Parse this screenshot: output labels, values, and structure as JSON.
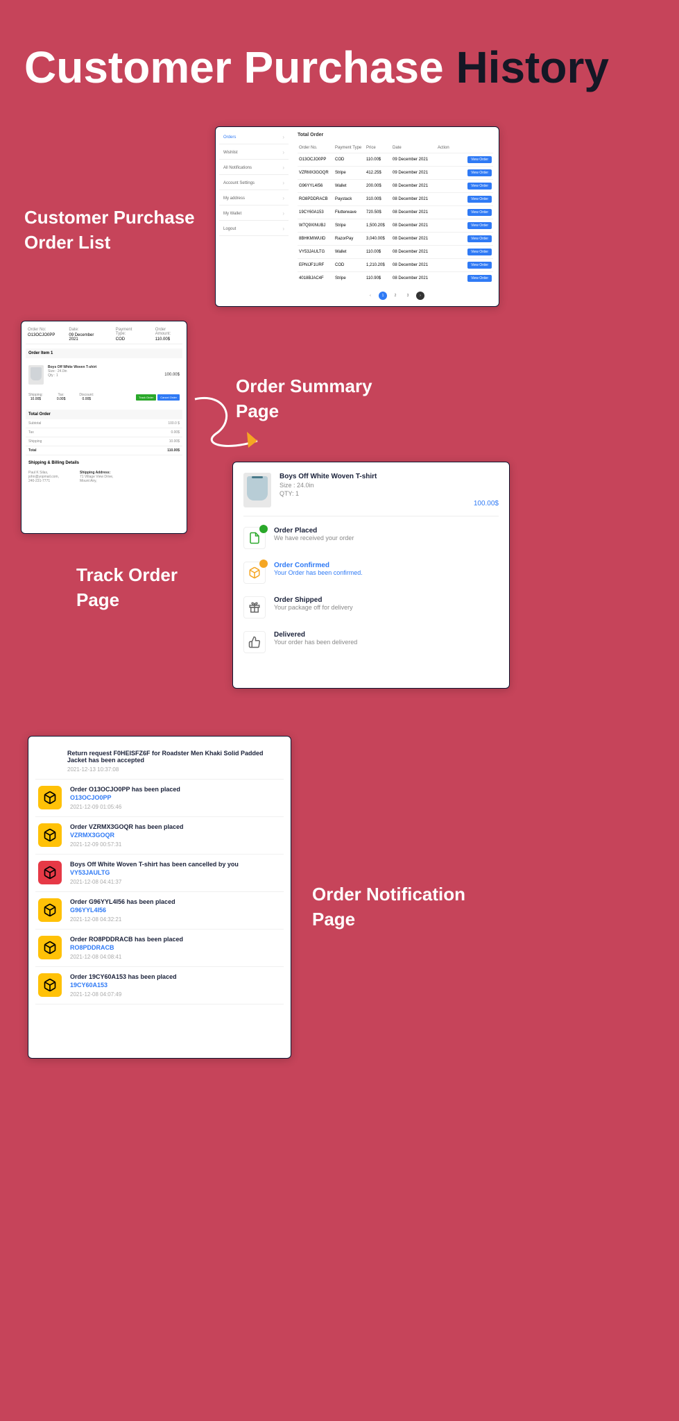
{
  "title": {
    "a": "Customer Purchase ",
    "b": "History"
  },
  "labels": {
    "order_list": "Customer Purchase\nOrder List",
    "summary": "Order Summary\nPage",
    "track": "Track Order\nPage",
    "notif": "Order Notification\nPage"
  },
  "sidebar": {
    "items": [
      {
        "label": "Orders",
        "active": true
      },
      {
        "label": "Wishlist"
      },
      {
        "label": "All Notifications"
      },
      {
        "label": "Account Settings"
      },
      {
        "label": "My address"
      },
      {
        "label": "My Wallet"
      },
      {
        "label": "Logout"
      }
    ]
  },
  "orders": {
    "title": "Total Order",
    "headers": {
      "no": "Order No.",
      "pay": "Payment Type",
      "price": "Price",
      "date": "Date",
      "action": "Action"
    },
    "view_label": "View Order",
    "rows": [
      {
        "no": "O13OCJO0PP",
        "pay": "COD",
        "price": "110.00$",
        "date": "09 December 2021"
      },
      {
        "no": "VZRMX3GOQR",
        "pay": "Stripe",
        "price": "412.25$",
        "date": "09 December 2021"
      },
      {
        "no": "G96YYL4I56",
        "pay": "Wallet",
        "price": "200.00$",
        "date": "08 December 2021"
      },
      {
        "no": "RO8PDDRACB",
        "pay": "Paystack",
        "price": "310.00$",
        "date": "08 December 2021"
      },
      {
        "no": "19CY60A153",
        "pay": "Flutterwave",
        "price": "720.50$",
        "date": "08 December 2021"
      },
      {
        "no": "W7Q9XINUBJ",
        "pay": "Stripe",
        "price": "1,500.20$",
        "date": "08 December 2021"
      },
      {
        "no": "8BHKMIWUID",
        "pay": "RazorPay",
        "price": "3,040.00$",
        "date": "08 December 2021"
      },
      {
        "no": "VY53JAULTG",
        "pay": "Wallet",
        "price": "110.00$",
        "date": "08 December 2021"
      },
      {
        "no": "EPNIJF1URF",
        "pay": "COD",
        "price": "1,210.20$",
        "date": "08 December 2021"
      },
      {
        "no": "4018BJAC4F",
        "pay": "Stripe",
        "price": "110.90$",
        "date": "08 December 2021"
      }
    ],
    "pages": [
      "1",
      "2",
      "3"
    ]
  },
  "track": {
    "head": {
      "no_l": "Order No:",
      "no_v": "O13OCJO0PP",
      "date_l": "Date:",
      "date_v": "09 December 2021",
      "pay_l": "Payment Type:",
      "pay_v": "COD",
      "amt_l": "Order Amount:",
      "amt_v": "110.00$"
    },
    "item_title": "Order Item 1",
    "item": {
      "name": "Boys Off White Woven T-shirt",
      "size": "Size : 24.0in",
      "qty": "Qty : 1",
      "price": "100.00$"
    },
    "line": {
      "ship_l": "Shipping:",
      "ship_v": "10.00$",
      "tax_l": "Tax:",
      "tax_v": "0.00$",
      "disc_l": "Discount:",
      "disc_v": "0.00$"
    },
    "btns": {
      "track": "Track Order",
      "cancel": "Cancel Order"
    },
    "totals": {
      "title": "Total Order",
      "rows": [
        {
          "l": "Subtotal",
          "v": "100.0 $"
        },
        {
          "l": "Tax",
          "v": "0.00$"
        },
        {
          "l": "Shipping",
          "v": "10.00$"
        },
        {
          "l": "Total",
          "v": "110.00$"
        }
      ]
    },
    "ship": {
      "title": "Shipping & Billing Details",
      "name": "Paul K Silas,",
      "email": "john@yopmail.com,",
      "phone": "240-231-7771",
      "addr_l": "Shipping Address:",
      "addr_v": "71 Village View Drive,\nMount Airy,"
    }
  },
  "summary": {
    "item": {
      "name": "Boys Off White Woven T-shirt",
      "size": "Size : 24.0in",
      "qty": "QTY: 1",
      "price": "100.00$"
    },
    "steps": [
      {
        "t": "Order Placed",
        "s": "We have received your order",
        "badge": "green",
        "icon": "doc"
      },
      {
        "t": "Order Confirmed",
        "s": "Your Order has been confirmed.",
        "badge": "orange",
        "icon": "box",
        "done": true
      },
      {
        "t": "Order Shipped",
        "s": "Your package off for delivery",
        "icon": "gift"
      },
      {
        "t": "Delivered",
        "s": "Your order has been delivered",
        "icon": "thumb"
      }
    ]
  },
  "notif": {
    "items": [
      {
        "title": "Return request F0HEISFZ6F for Roadster Men Khaki Solid Padded Jacket has been accepted",
        "date": "2021-12-13 10:37:08",
        "noicon": true
      },
      {
        "title": "Order O13OCJO0PP has been placed",
        "code": "O13OCJO0PP",
        "date": "2021-12-09 01:05:46",
        "color": "yellow"
      },
      {
        "title": "Order VZRMX3GOQR has been placed",
        "code": "VZRMX3GOQR",
        "date": "2021-12-09 00:57:31",
        "color": "yellow"
      },
      {
        "title": "Boys Off White Woven T-shirt has been cancelled by you",
        "code": "VY53JAULTG",
        "date": "2021-12-08 04:41:37",
        "color": "red"
      },
      {
        "title": "Order G96YYL4I56 has been placed",
        "code": "G96YYL4I56",
        "date": "2021-12-08 04:32:21",
        "color": "yellow"
      },
      {
        "title": "Order RO8PDDRACB has been placed",
        "code": "RO8PDDRACB",
        "date": "2021-12-08 04:08:41",
        "color": "yellow"
      },
      {
        "title": "Order 19CY60A153 has been placed",
        "code": "19CY60A153",
        "date": "2021-12-08 04:07:49",
        "color": "yellow"
      }
    ]
  }
}
